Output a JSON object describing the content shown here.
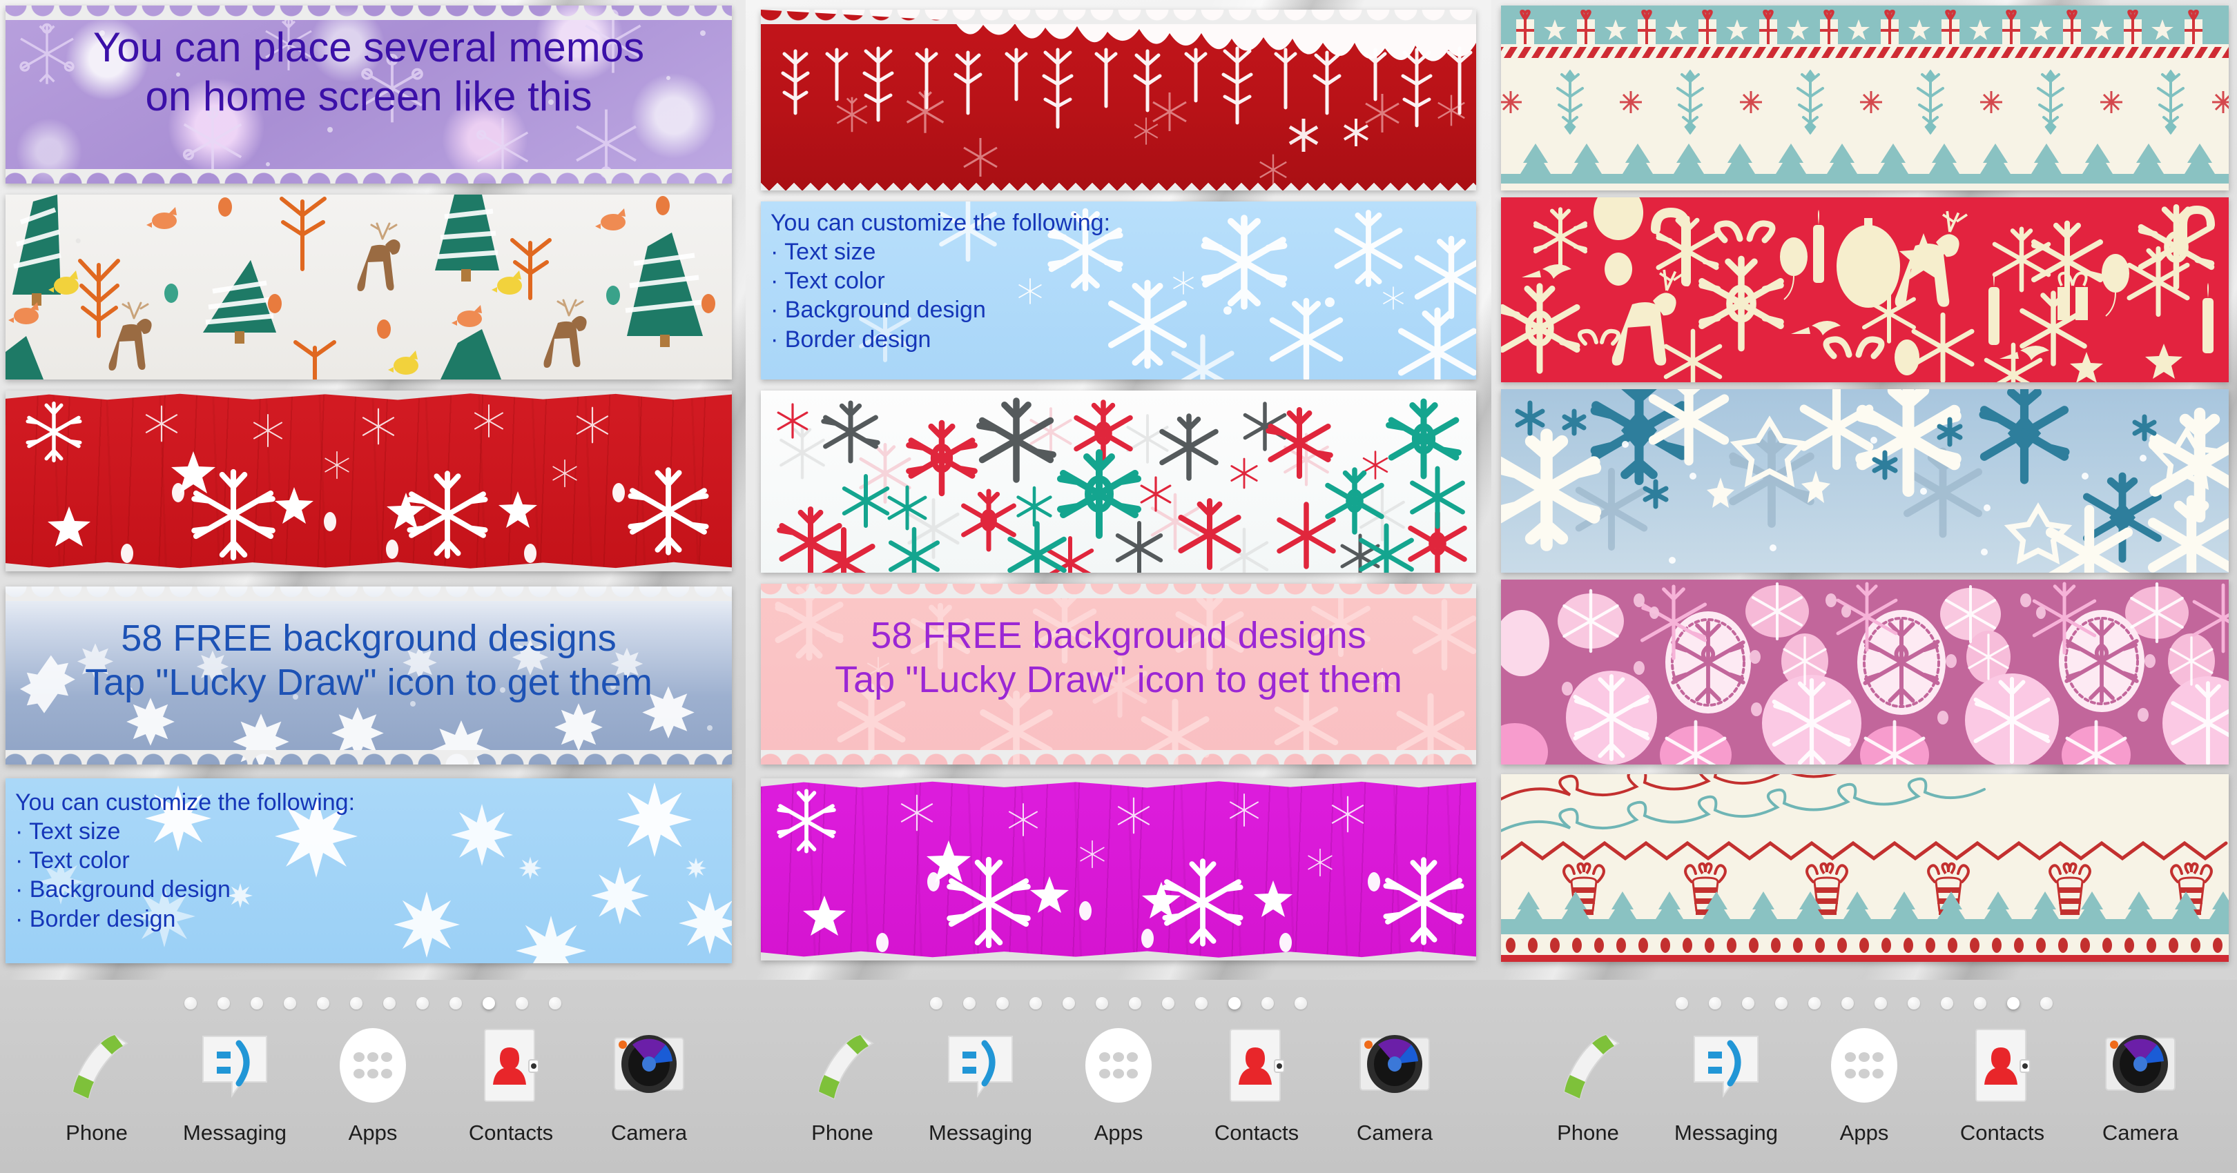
{
  "app": {
    "home_screens": 3,
    "page_indicator": {
      "total_dots": 12,
      "active_index": [
        9,
        9,
        10
      ]
    },
    "dock": {
      "items": [
        {
          "label": "Phone",
          "icon": "phone-icon"
        },
        {
          "label": "Messaging",
          "icon": "messaging-icon"
        },
        {
          "label": "Apps",
          "icon": "apps-grid-icon"
        },
        {
          "label": "Contacts",
          "icon": "contacts-icon"
        },
        {
          "label": "Camera",
          "icon": "camera-icon"
        }
      ]
    }
  },
  "colors": {
    "purple_text": "#3b10a8",
    "blue_text": "#1536b8",
    "steelblue_text": "#1d52b5",
    "violet_text": "#9b27d4",
    "memo_purple_bg": "#ab92d6",
    "memo_red_bg": "#c9161d",
    "memo_magenta_bg": "#d81fd4",
    "memo_lightblue_bg": "#a7d6f7",
    "memo_pink_bg": "#fbc6c7",
    "nordic_cream": "#f7f3e6",
    "nordic_red": "#e3233f",
    "nordic_teal": "#7fbdbd",
    "pink_circle_bg": "#c2669b",
    "dock_bg": "#c9c9c9"
  },
  "screen1": {
    "memos": [
      {
        "id": "memo-intro-purple",
        "style": "purple-bokeh-snowflakes",
        "border": "scallop",
        "align": "center",
        "text": "You can place several memos\non home screen like this"
      },
      {
        "id": "memo-winter-forest",
        "style": "winter-forest-paper",
        "border": "straight",
        "align": "center",
        "text": ""
      },
      {
        "id": "memo-red-grunge",
        "style": "red-grunge-snowflakes",
        "border": "torn",
        "align": "center",
        "text": ""
      },
      {
        "id": "memo-lucky-draw-steelblue",
        "style": "steel-blue-snowfall",
        "border": "scallop",
        "align": "center",
        "text": "58 FREE background designs\nTap \"Lucky Draw\" icon to get them"
      },
      {
        "id": "memo-customize-lightblue",
        "style": "light-blue-snowflakes",
        "border": "straight",
        "align": "left",
        "text": "You can customize the following:\n· Text size\n· Text color\n· Background design\n· Border design"
      }
    ]
  },
  "screen2": {
    "memos": [
      {
        "id": "memo-deep-red-snowfall",
        "style": "deep-red-hanging-snowflakes",
        "border": "scallop-zigzag",
        "align": "center",
        "text": ""
      },
      {
        "id": "memo-customize-lightblue-2",
        "style": "light-blue-snowflakes",
        "border": "straight",
        "align": "left",
        "text": "You can customize the following:\n· Text size\n· Text color\n· Background design\n· Border design"
      },
      {
        "id": "memo-white-colour-snowflakes",
        "style": "white-multicolour-snowflakes",
        "border": "straight",
        "align": "center",
        "text": ""
      },
      {
        "id": "memo-lucky-draw-pink",
        "style": "pink-snowflakes",
        "border": "scallop",
        "align": "center",
        "text": "58 FREE background designs\nTap \"Lucky Draw\" icon to get them"
      },
      {
        "id": "memo-magenta-grunge",
        "style": "magenta-grunge-snowflakes",
        "border": "torn",
        "align": "center",
        "text": ""
      }
    ]
  },
  "screen3": {
    "memos": [
      {
        "id": "memo-nordic-gifts-trees",
        "style": "nordic-gifts-stripes-trees",
        "border": "straight",
        "align": "center",
        "text": ""
      },
      {
        "id": "memo-red-christmas-icons",
        "style": "red-christmas-icon-pattern",
        "border": "straight",
        "align": "center",
        "text": ""
      },
      {
        "id": "memo-icy-blue-snowflakes",
        "style": "icy-blue-large-snowflakes",
        "border": "straight",
        "align": "center",
        "text": ""
      },
      {
        "id": "memo-pink-snowflake-circles",
        "style": "pink-snowflake-medallions",
        "border": "straight",
        "align": "center",
        "text": ""
      },
      {
        "id": "memo-nordic-ornaments",
        "style": "nordic-swirls-ornaments-trees",
        "border": "straight",
        "align": "center",
        "text": ""
      }
    ]
  }
}
